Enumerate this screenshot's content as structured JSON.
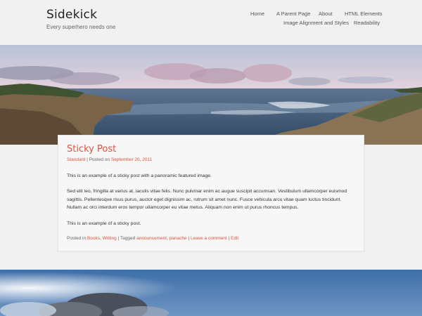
{
  "site": {
    "title": "Sidekick",
    "tagline": "Every superhero needs one"
  },
  "nav": {
    "home": "Home",
    "parent_page": "A Parent Page",
    "about": "About",
    "html_elements": "HTML Elements",
    "image_alignment": "Image Alignment and Styles",
    "readability": "Readability"
  },
  "post": {
    "title": "Sticky Post",
    "format": "Standard",
    "separator": "|",
    "posted_on": "Posted on",
    "date": "September 20, 2011",
    "p1": "This is an example of a sticky post with a panoramic featured image.",
    "p2": "Sed elit leo, fringilla at varius at, iaculis vitae felis. Nunc pulvinar enim ac augue suscipit accumsan. Vestibulum ullamcorper euismod sagittis. Pellentesque risus purus, auctor eget dignissim ac, rutrum sit amet nunc. Fusce vehicula arcu vitae quam luctus tincidunt. Nullam ac orci interdum eros tempor ullamcorper eu vitae metus. Aliquam non enim ut purus rhoncus tempus.",
    "p3": "This is an example of a sticky post.",
    "footer": {
      "posted_in": "Posted in",
      "cat1": "Books",
      "comma": ",",
      "cat2": "Writing",
      "tagged": "Tagged",
      "tag1": "announcement",
      "tag2": "panache",
      "leave_comment": "Leave a comment",
      "edit": "Edit"
    }
  },
  "colors": {
    "accent": "#e0503b",
    "background": "#f1f1f1",
    "card": "#f7f7f7"
  }
}
